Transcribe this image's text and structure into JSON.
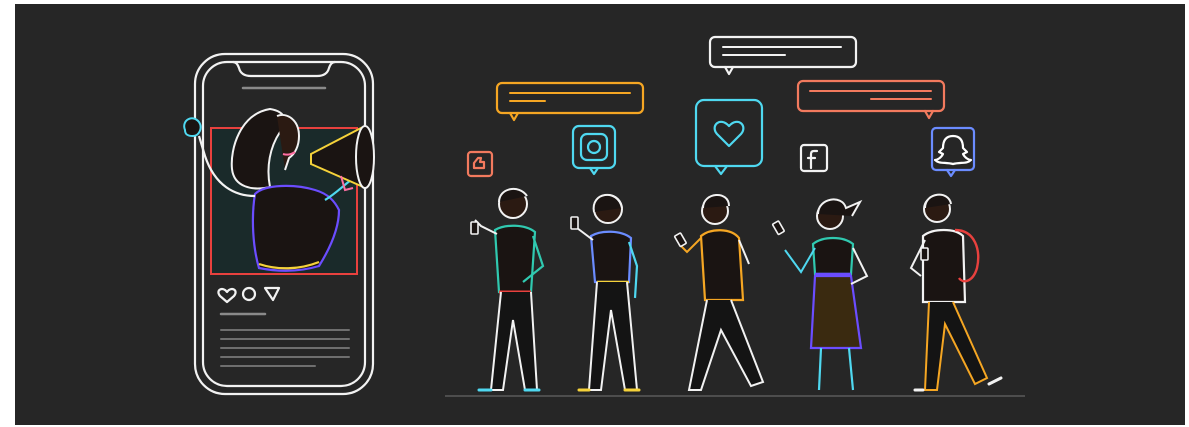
{
  "illustration": {
    "background": "#262626",
    "palette": {
      "white": "#f2f2f2",
      "red": "#e8413e",
      "orange": "#f5a623",
      "cyan": "#4fd8f0",
      "teal": "#30c9b0",
      "purple": "#6b4dff",
      "pink": "#ff6fa3",
      "yellow": "#f5d23a",
      "body_fill": "#1a1412",
      "skin_dark": "#2b1a12"
    },
    "icons": [
      "like-icon",
      "instagram-icon",
      "heart-icon",
      "facebook-icon",
      "snapchat-icon",
      "megaphone-icon",
      "comment-icon",
      "share-icon"
    ],
    "people_count": 5
  }
}
